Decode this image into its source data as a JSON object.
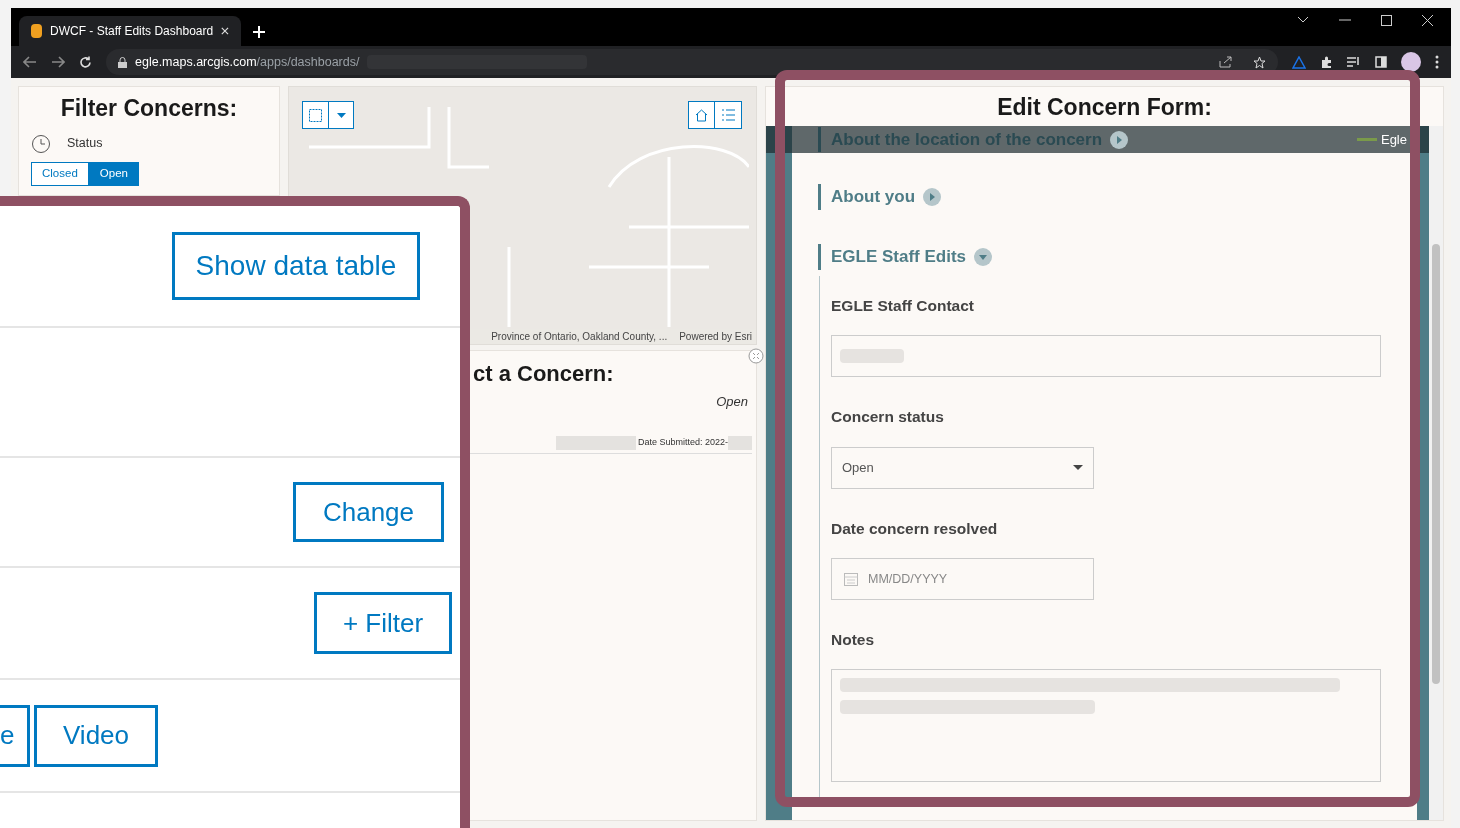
{
  "browser": {
    "tab_title": "DWCF - Staff Edits Dashboard",
    "url_host": "egle.maps.arcgis.com",
    "url_path": "/apps/dashboards/"
  },
  "filter_panel": {
    "title": "Filter Concerns:",
    "category": "Status",
    "options": [
      {
        "label": "Closed",
        "selected": false
      },
      {
        "label": "Open",
        "selected": true
      }
    ]
  },
  "map": {
    "attribution": "Province of Ontario, Oakland County, ...",
    "powered_by": "Powered by Esri"
  },
  "list_panel": {
    "title": "ct a Concern:",
    "items": [
      {
        "status": "Open",
        "date_label": "Date Submitted: 2022-"
      }
    ]
  },
  "form": {
    "title": "Edit Concern Form:",
    "brand": "Egle",
    "sections": [
      {
        "label": "About the location of the concern",
        "expanded": false
      },
      {
        "label": "About you",
        "expanded": false
      },
      {
        "label": "EGLE Staff Edits",
        "expanded": true
      }
    ],
    "fields": [
      {
        "kind": "text",
        "label": "EGLE Staff Contact"
      },
      {
        "kind": "select",
        "label": "Concern status",
        "value": "Open"
      },
      {
        "kind": "date",
        "label": "Date concern resolved",
        "placeholder": "MM/DD/YYYY"
      },
      {
        "kind": "textarea",
        "label": "Notes"
      }
    ]
  },
  "callout": {
    "buttons": [
      "Show data table",
      "Change",
      "+ Filter",
      "e",
      "Video"
    ]
  }
}
